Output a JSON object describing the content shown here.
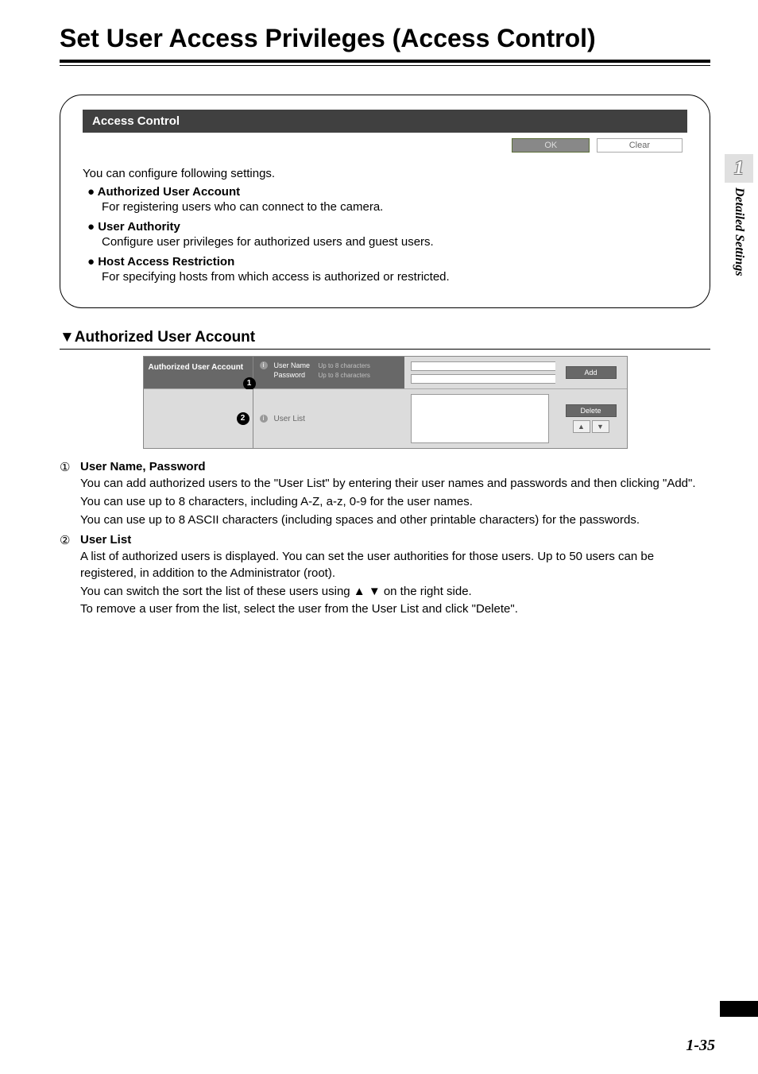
{
  "page": {
    "title": "Set User Access Privileges (Access Control)",
    "number": "1-35"
  },
  "sidebar": {
    "chapter_number": "1",
    "chapter_title": "Detailed Settings"
  },
  "panel": {
    "header": "Access Control",
    "ok_button": "OK",
    "clear_button": "Clear",
    "intro": "You can configure following settings.",
    "bullets": [
      {
        "head": "● Authorized User Account",
        "desc": "For registering users who can connect to the camera."
      },
      {
        "head": "● User Authority",
        "desc": "Configure user privileges for authorized users and guest users."
      },
      {
        "head": "● Host Access Restriction",
        "desc": "For specifying hosts from which access is authorized or restricted."
      }
    ]
  },
  "auth_section": {
    "heading": "▼Authorized User Account",
    "left_label": "Authorized User Account",
    "username_label": "User Name",
    "username_hint": "Up to 8 characters",
    "password_label": "Password",
    "password_hint": "Up to 8 characters",
    "add_button": "Add",
    "userlist_label": "User List",
    "delete_button": "Delete",
    "sort_up": "▲",
    "sort_down": "▼",
    "marker1": "1",
    "marker2": "2"
  },
  "descriptions": [
    {
      "num": "①",
      "title": "User Name, Password",
      "paras": [
        "You can add authorized users to the \"User List\" by entering their user names and passwords and then clicking \"Add\".",
        "You can use up to 8 characters, including A-Z, a-z, 0-9 for the user names.",
        "You can use up to 8 ASCII characters (including spaces and other printable characters) for the passwords."
      ]
    },
    {
      "num": "②",
      "title": "User List",
      "paras": [
        "A list of authorized users is displayed. You can set the user authorities for those users. Up to 50 users can be registered, in addition to the Administrator (root).",
        "You can switch the sort the list of these users using ▲ ▼ on the right side.",
        "To remove a user from the list, select the user from the User List and click \"Delete\"."
      ]
    }
  ]
}
